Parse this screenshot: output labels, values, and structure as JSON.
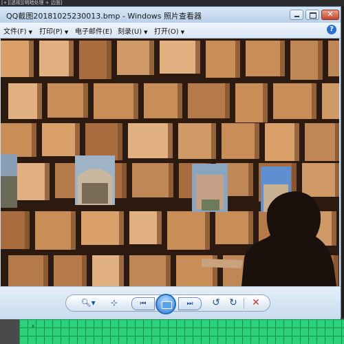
{
  "background_app": {
    "top_strip_text": "[+][透视][明暗处理 + 边面]",
    "axis_label": "x"
  },
  "window": {
    "title": "QQ截图20181025230013.bmp - Windows 照片查看器",
    "menu": [
      {
        "label": "文件(F)",
        "has_dropdown": true
      },
      {
        "label": "打印(P)",
        "has_dropdown": true
      },
      {
        "label": "电子邮件(E)",
        "has_dropdown": false
      },
      {
        "label": "刻录(U)",
        "has_dropdown": true
      },
      {
        "label": "打开(O)",
        "has_dropdown": true
      }
    ],
    "help_icon": "?"
  },
  "controls": {
    "zoom": "zoom-icon",
    "fit": "actual-size-icon",
    "prev": "previous-icon",
    "slideshow": "slideshow-icon",
    "next": "next-icon",
    "rotate_left": "rotate-ccw-icon",
    "rotate_right": "rotate-cw-icon",
    "delete": "delete-icon"
  },
  "colors": {
    "tile_light": "#d9a06a",
    "tile_mid": "#b57a4a",
    "tile_dark": "#3a2418",
    "accent": "#2a7bd6"
  }
}
